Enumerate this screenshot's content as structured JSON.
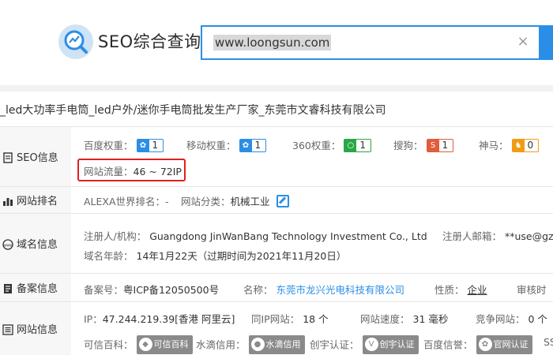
{
  "header": {
    "brand": "SEO综合查询",
    "search_value": "www.loongsun.com",
    "clear_symbol": "×"
  },
  "site_title": "_led大功率手电筒_led户外/迷你手电筒批发生产厂家_东莞市文睿科技有限公司",
  "seo": {
    "label": "SEO信息",
    "baidu_label": "百度权重：",
    "baidu_value": "1",
    "mobile_label": "移动权重：",
    "mobile_value": "1",
    "s360_label": "360权重：",
    "s360_value": "1",
    "sogou_label": "搜狗：",
    "sogou_value": "1",
    "shenma_label": "神马：",
    "shenma_value": "0",
    "traffic_label": "网站流量：",
    "traffic_value": "46 ~ 72IP"
  },
  "rank": {
    "label": "网站排名",
    "alexa_label": "ALEXA世界排名：",
    "alexa_value": "-",
    "category_label": "网站分类：",
    "category_value": "机械工业"
  },
  "domain": {
    "label": "域名信息",
    "registrant_label": "注册人/机构：",
    "registrant_value": "Guangdong JinWanBang Technology Investment Co., Ltd",
    "email_label": "注册人邮箱：",
    "email_value": "**use@gzid",
    "age_label": "域名年龄：",
    "age_value": "14年1月22天（过期时间为2021年11月20日）"
  },
  "icp": {
    "label": "备案信息",
    "number_label": "备案号：",
    "number_value": "粤ICP备12050500号",
    "name_label": "名称：",
    "name_value": "东莞市龙兴光电科技有限公司",
    "nature_label": "性质：",
    "nature_value": "企业",
    "review_label": "审核时"
  },
  "site": {
    "label": "网站信息",
    "ip_label": "IP：",
    "ip_value": "47.244.219.39[香港 阿里云]",
    "sameip_label": "同IP网站：",
    "sameip_value": "18 个",
    "speed_label": "网站速度：",
    "speed_value": "31 毫秒",
    "compete_label": "竞争网站：",
    "compete_value": "0 个",
    "kexin_label": "可信百科：",
    "kexin_badge": "可信百科",
    "shuidi_label": "水滴信用：",
    "shuidi_badge": "水滴信用",
    "chuangyu_label": "创宇认证：",
    "chuangyu_badge": "创宇认证",
    "baiduxin_label": "百度信誉：",
    "baiduxin_badge": "官网认证",
    "ss_label": "SS"
  },
  "colors": {
    "accent": "#2b8ee6",
    "highlight_box": "#e02020"
  }
}
